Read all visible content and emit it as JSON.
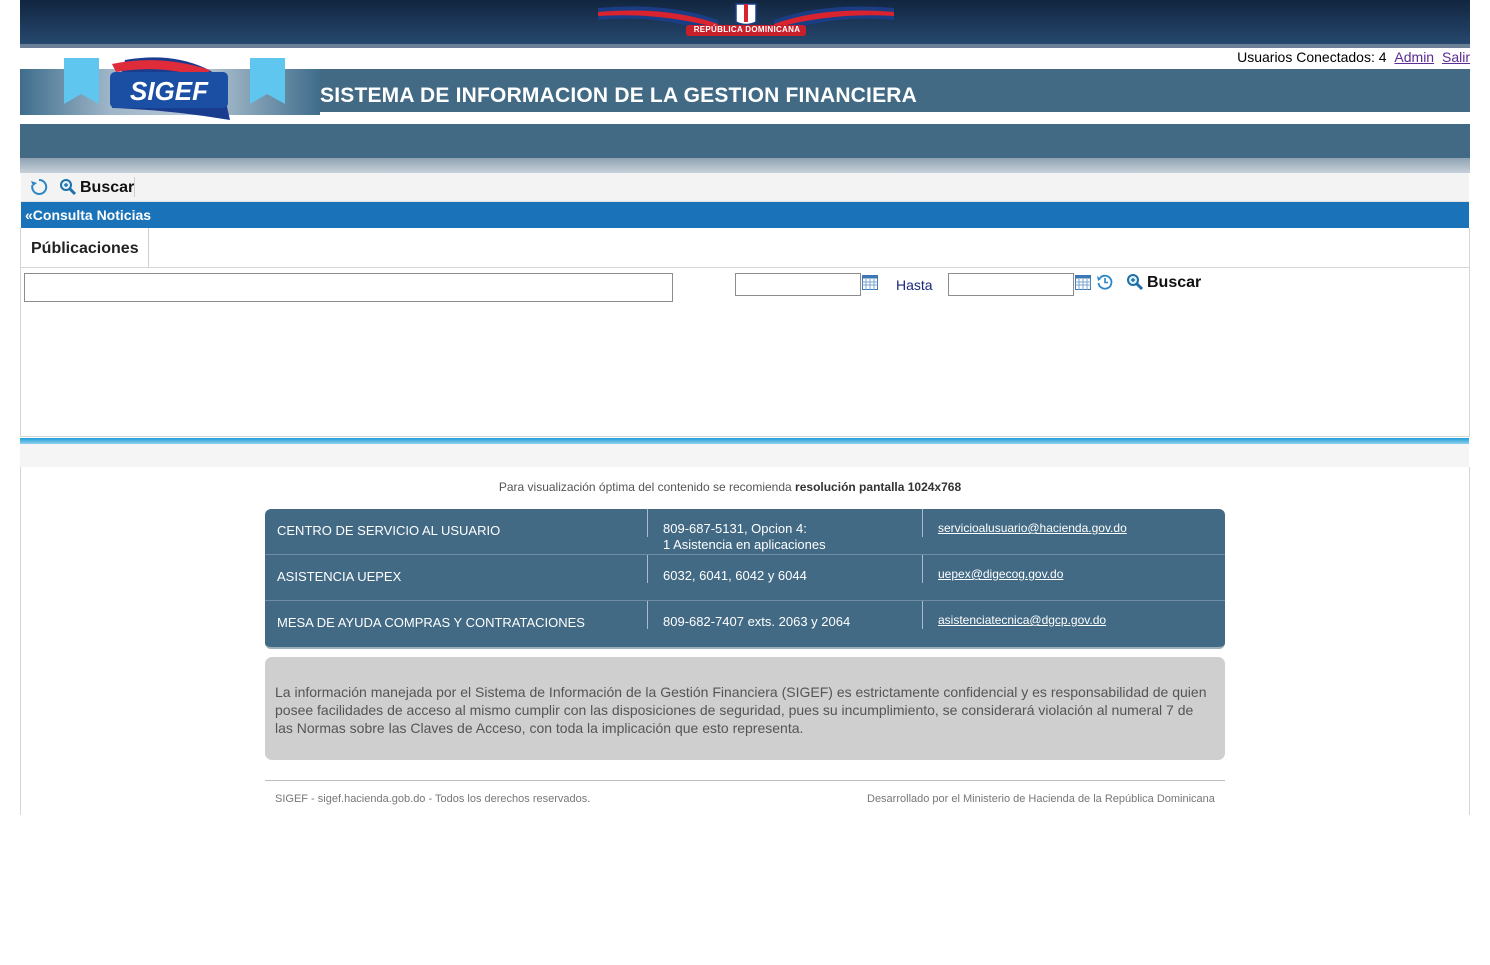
{
  "banner": {
    "emblem_text": "REPÚBLICA DOMINICANA"
  },
  "header": {
    "users_label": "Usuarios Conectados: 4",
    "user_link": "Admin",
    "logout_link": "Salir",
    "logo_text": "SIGEF",
    "system_title": "SISTEMA DE INFORMACION DE LA GESTION FINANCIERA"
  },
  "toolbar": {
    "search_label": "Buscar"
  },
  "section": {
    "title": "«Consulta Noticias"
  },
  "tabs": [
    {
      "label": "Públicaciones"
    }
  ],
  "filters": {
    "text_value": "",
    "from_value": "",
    "to_label": "Hasta",
    "to_value": "",
    "search_label": "Buscar"
  },
  "recommendation": {
    "text": "Para visualización óptima del contenido se recomienda",
    "bold": "resolución pantalla 1024x768"
  },
  "support": [
    {
      "name": "CENTRO DE SERVICIO AL USUARIO",
      "phone_line1": "809-687-5131, Opcion 4:",
      "phone_line2": "1 Asistencia en aplicaciones",
      "email": "servicioalusuario@hacienda.gov.do"
    },
    {
      "name": "ASISTENCIA UEPEX",
      "phone_line1": "6032, 6041, 6042 y 6044",
      "phone_line2": "",
      "email": "uepex@digecog.gov.do"
    },
    {
      "name": "MESA DE AYUDA COMPRAS Y CONTRATACIONES",
      "phone_line1": "809-682-7407 exts. 2063 y 2064",
      "phone_line2": "",
      "email": "asistenciatecnica@dgcp.gov.do"
    }
  ],
  "notice": {
    "text": "La información manejada por el Sistema de Información de la Gestión Financiera (SIGEF) es estrictamente confidencial y es responsabilidad de quien posee facilidades de acceso al mismo cumplir con las disposiciones de seguridad, pues su incumplimiento, se considerará violación al numeral 7 de las Normas sobre las Claves de Acceso, con toda la implicación que esto representa."
  },
  "footer": {
    "left": "SIGEF - sigef.hacienda.gob.do - Todos los derechos reservados.",
    "right": "Desarrollado por el Ministerio de Hacienda de la República Dominicana"
  },
  "colors": {
    "header_blue": "#426a84",
    "section_blue": "#1a73b8",
    "banner_navy": "#11253f"
  }
}
